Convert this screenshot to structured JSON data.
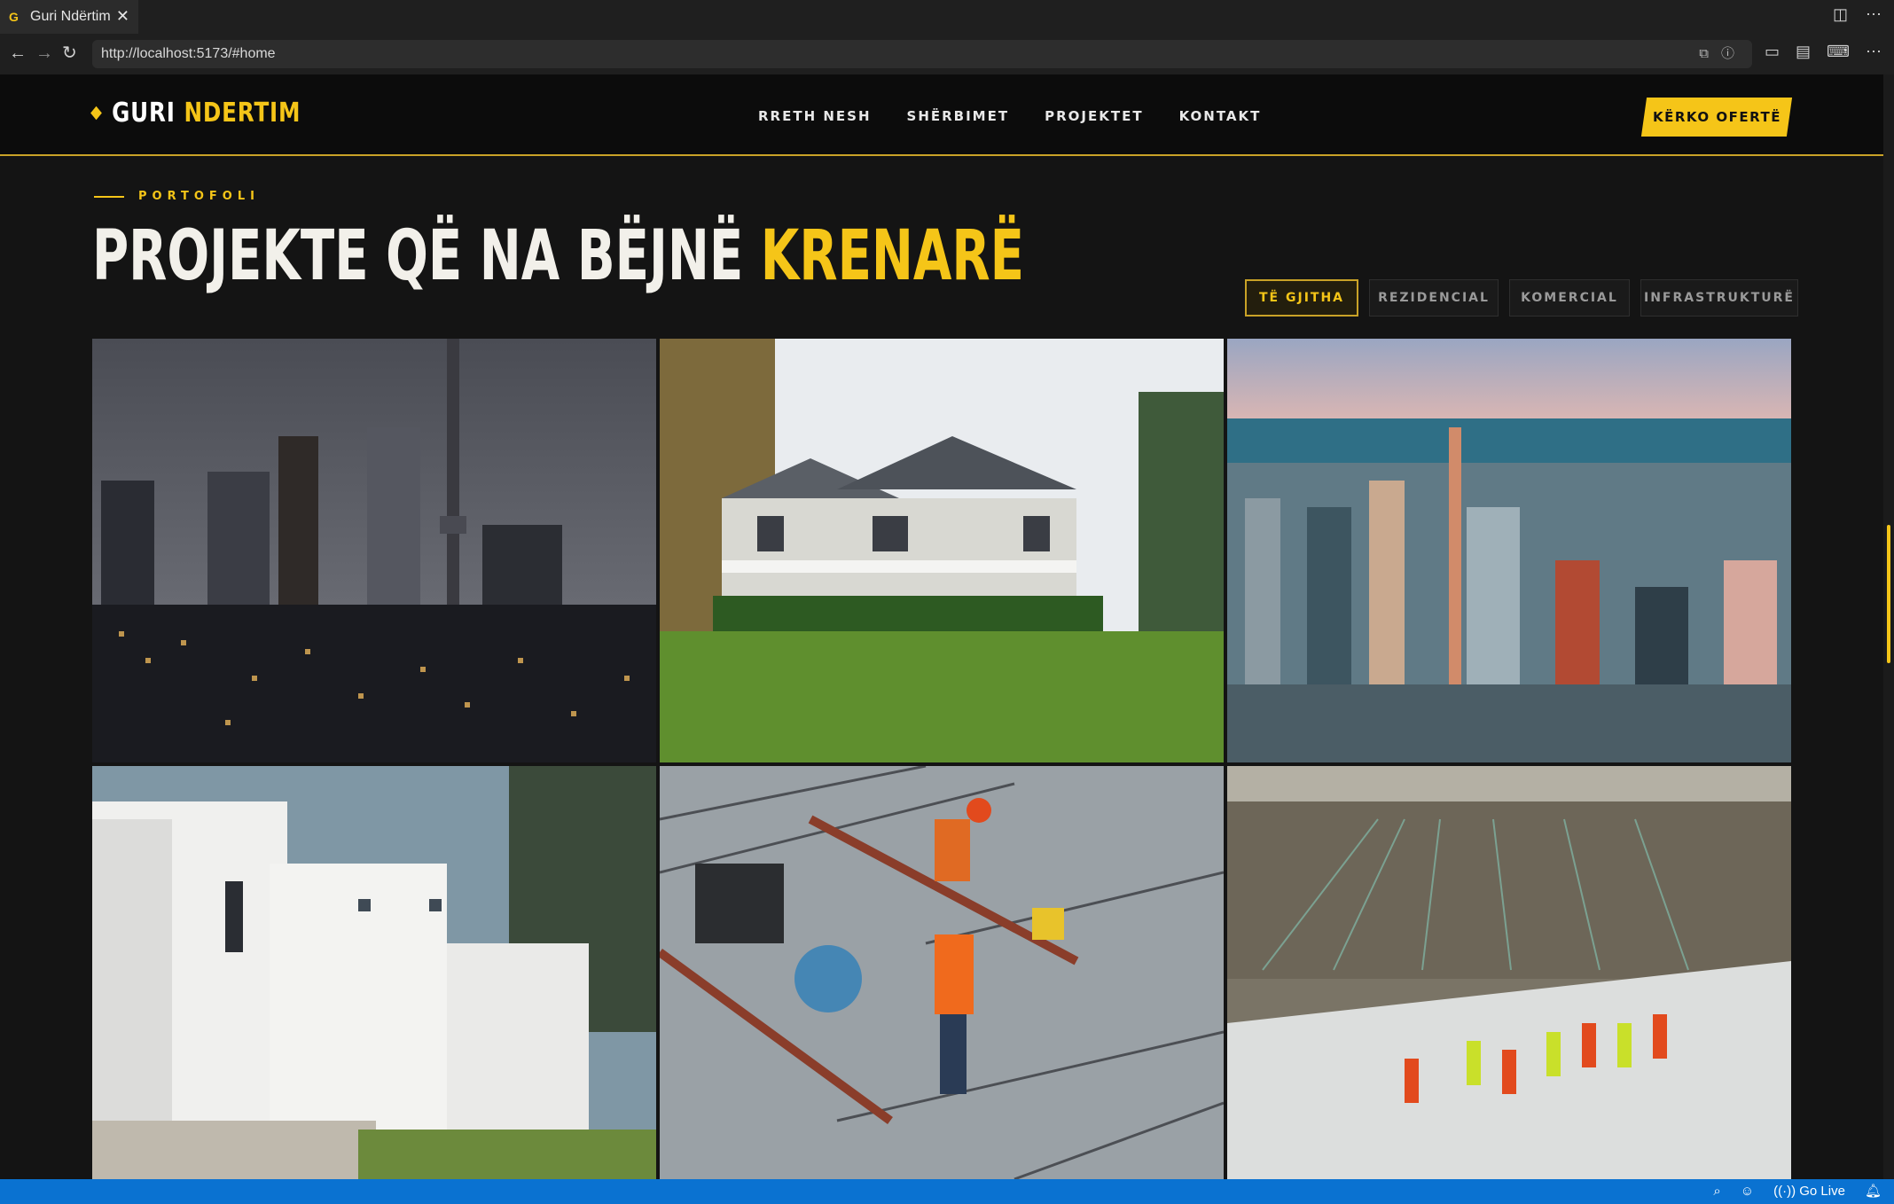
{
  "browser": {
    "tab_title": "Guri Ndërtim",
    "tab_favicon": "G",
    "close_glyph": "✕",
    "url": "http://localhost:5173/#home"
  },
  "site": {
    "logo_white": "GURI",
    "logo_yellow": "NDERTIM",
    "nav": [
      "RRETH NESH",
      "SHËRBIMET",
      "PROJEKTET",
      "KONTAKT"
    ],
    "cta": "KËRKO OFERTË"
  },
  "portfolio": {
    "kicker": "PORTOFOLI",
    "title_white": "PROJEKTE QË NA BËJNË",
    "title_yellow": "KRENARË",
    "filters": [
      "TË GJITHA",
      "REZIDENCIAL",
      "KOMERCIAL",
      "INFRASTRUKTURË"
    ],
    "active_filter": "TË GJITHA"
  },
  "status": {
    "go_live": "Go Live"
  },
  "colors": {
    "accent": "#f5c518",
    "background": "#141414",
    "header": "#0c0c0c",
    "statusbar": "#0a72d1"
  },
  "icons": [
    "back-icon",
    "forward-icon",
    "reload-icon",
    "split-view-icon",
    "more-icon",
    "zoom-icon",
    "copilot-icon",
    "broadcast-icon",
    "bell-icon"
  ]
}
